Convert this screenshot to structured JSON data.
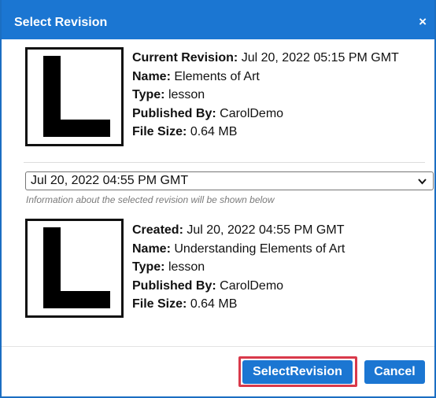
{
  "dialog": {
    "title": "Select Revision",
    "close_glyph": "×"
  },
  "current": {
    "thumbnail_letter": "L",
    "rows": [
      {
        "label": "Current Revision:",
        "value": "Jul 20, 2022 05:15 PM GMT"
      },
      {
        "label": "Name:",
        "value": "Elements of Art"
      },
      {
        "label": "Type:",
        "value": "lesson"
      },
      {
        "label": "Published By:",
        "value": "CarolDemo"
      },
      {
        "label": "File Size:",
        "value": "0.64 MB"
      }
    ]
  },
  "revision_select": {
    "selected": "Jul 20, 2022 04:55 PM GMT",
    "hint": "Information about the selected revision will be shown below"
  },
  "selected": {
    "thumbnail_letter": "L",
    "rows": [
      {
        "label": "Created:",
        "value": "Jul 20, 2022 04:55 PM GMT"
      },
      {
        "label": "Name:",
        "value": "Understanding Elements of Art"
      },
      {
        "label": "Type:",
        "value": "lesson"
      },
      {
        "label": "Published By:",
        "value": "CarolDemo"
      },
      {
        "label": "File Size:",
        "value": "0.64 MB"
      }
    ]
  },
  "footer": {
    "select_label": "SelectRevision",
    "cancel_label": "Cancel"
  },
  "colors": {
    "accent": "#1b76d2",
    "highlight": "#d9394a"
  }
}
